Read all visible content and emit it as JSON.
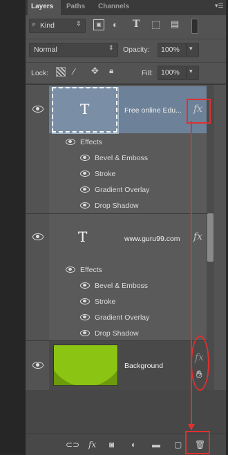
{
  "tabs": [
    {
      "label": "Layers",
      "active": true
    },
    {
      "label": "Paths",
      "active": false
    },
    {
      "label": "Channels",
      "active": false
    }
  ],
  "filter": {
    "kind_label": "Kind"
  },
  "blend": {
    "mode": "Normal",
    "opacity_label": "Opacity:",
    "opacity_value": "100%"
  },
  "lock": {
    "label": "Lock:",
    "fill_label": "Fill:",
    "fill_value": "100%"
  },
  "layers": [
    {
      "name": "Free online Edu...",
      "thumb": "T",
      "fx": "fx",
      "effects_label": "Effects",
      "effects": [
        "Bevel & Emboss",
        "Stroke",
        "Gradient Overlay",
        "Drop Shadow"
      ]
    },
    {
      "name": "www.guru99.com",
      "thumb": "T",
      "fx": "fx",
      "effects_label": "Effects",
      "effects": [
        "Bevel & Emboss",
        "Stroke",
        "Gradient Overlay",
        "Drop Shadow"
      ]
    },
    {
      "name": "Background",
      "fx": "fx"
    }
  ],
  "colors": {
    "panel": "#535353",
    "selected_layer": "#6d8298",
    "background_thumb": "#6c9a0c",
    "annotation": "#e03030"
  },
  "icons": {
    "bottom_toolbar": [
      "link-icon",
      "fx-icon",
      "mask-icon",
      "adjustment-icon",
      "folder-icon",
      "new-layer-icon",
      "trash-icon"
    ]
  }
}
